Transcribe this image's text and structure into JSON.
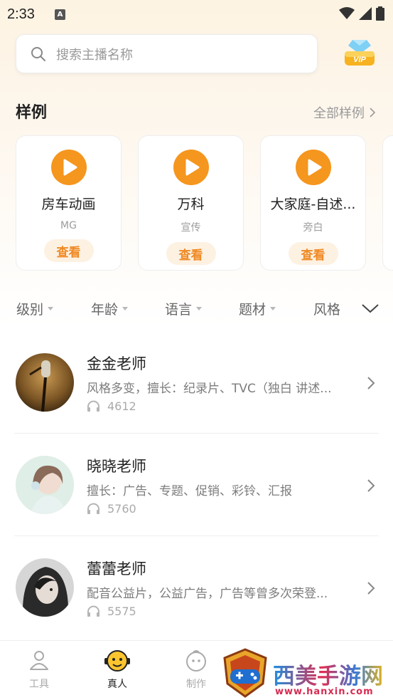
{
  "status_bar": {
    "time": "2:33",
    "notification_badge": "A"
  },
  "search": {
    "placeholder": "搜索主播名称"
  },
  "vip": {
    "label": "VIP"
  },
  "samples": {
    "title": "样例",
    "more_label": "全部样例",
    "cards": [
      {
        "title": "房车动画",
        "subtitle": "MG",
        "button": "查看"
      },
      {
        "title": "万科",
        "subtitle": "宣传",
        "button": "查看"
      },
      {
        "title": "大家庭-自述...",
        "subtitle": "旁白",
        "button": "查看"
      }
    ]
  },
  "filters": [
    "级别",
    "年龄",
    "语言",
    "题材",
    "风格"
  ],
  "teachers": [
    {
      "name": "金金老师",
      "description": "风格多变，擅长：纪录片、TVC（独白 讲述...",
      "listens": "4612"
    },
    {
      "name": "晓晓老师",
      "description": "擅长：广告、专题、促销、彩铃、汇报",
      "listens": "5760"
    },
    {
      "name": "蕾蕾老师",
      "description": "配音公益片，公益广告，广告等曾多次荣登...",
      "listens": "5575"
    }
  ],
  "bottom_nav": [
    {
      "label": "工具",
      "icon": "tools-icon",
      "active": false
    },
    {
      "label": "真人",
      "icon": "mascot-icon",
      "active": true
    },
    {
      "label": "制作",
      "icon": "create-icon",
      "active": false
    }
  ],
  "watermark": {
    "text": "西美手游网",
    "url": "www.hanxin.com"
  },
  "colors": {
    "accent": "#f5961e",
    "accent_light": "#fdf1e2",
    "text": "#222222",
    "muted": "#9a9a9a"
  }
}
